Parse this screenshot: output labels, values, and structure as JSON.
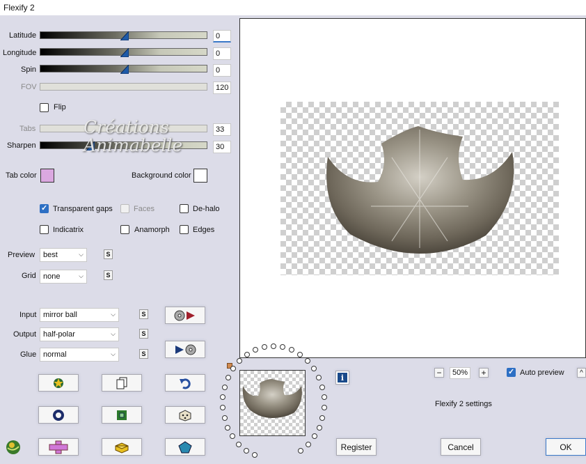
{
  "window": {
    "title": "Flexify 2"
  },
  "sliders": [
    {
      "id": "latitude",
      "label": "Latitude",
      "value": "0",
      "enabled": true,
      "level": 0.5
    },
    {
      "id": "longitude",
      "label": "Longitude",
      "value": "0",
      "enabled": true,
      "level": 0.5
    },
    {
      "id": "spin",
      "label": "Spin",
      "value": "0",
      "enabled": true,
      "level": 0.5
    },
    {
      "id": "fov",
      "label": "FOV",
      "value": "120",
      "enabled": false,
      "level": 1.0
    },
    {
      "id": "tabs",
      "label": "Tabs",
      "value": "33",
      "enabled": false,
      "level": 0.33
    },
    {
      "id": "sharpen",
      "label": "Sharpen",
      "value": "30",
      "enabled": true,
      "level": 0.3
    }
  ],
  "flip": {
    "label": "Flip",
    "checked": false
  },
  "colors": {
    "tab_color_label": "Tab color",
    "tab_color": "#dba8e0",
    "background_color_label": "Background color",
    "background_color": "#ffffff"
  },
  "options": {
    "transparent_gaps": {
      "label": "Transparent gaps",
      "checked": true
    },
    "faces": {
      "label": "Faces",
      "checked": false,
      "enabled": false
    },
    "de_halo": {
      "label": "De-halo",
      "checked": false
    },
    "indicatrix": {
      "label": "Indicatrix",
      "checked": false
    },
    "anamorph": {
      "label": "Anamorph",
      "checked": false
    },
    "edges": {
      "label": "Edges",
      "checked": false
    }
  },
  "selects": {
    "preview": {
      "label": "Preview",
      "value": "best"
    },
    "grid": {
      "label": "Grid",
      "value": "none"
    },
    "input": {
      "label": "Input",
      "value": "mirror ball"
    },
    "output": {
      "label": "Output",
      "value": "half-polar"
    },
    "glue": {
      "label": "Glue",
      "value": "normal"
    }
  },
  "small_button_label": "S",
  "watermark": {
    "line1": "Créations",
    "line2": "Animabelle"
  },
  "zoom": {
    "minus": "−",
    "value": "50%",
    "plus": "+"
  },
  "auto_preview": {
    "label": "Auto preview",
    "checked": true
  },
  "settings_label": "Flexify 2 settings",
  "buttons": {
    "register": "Register",
    "cancel": "Cancel",
    "ok": "OK",
    "info": "i",
    "collapse": "^"
  },
  "accent_color": "#2d6fc4"
}
